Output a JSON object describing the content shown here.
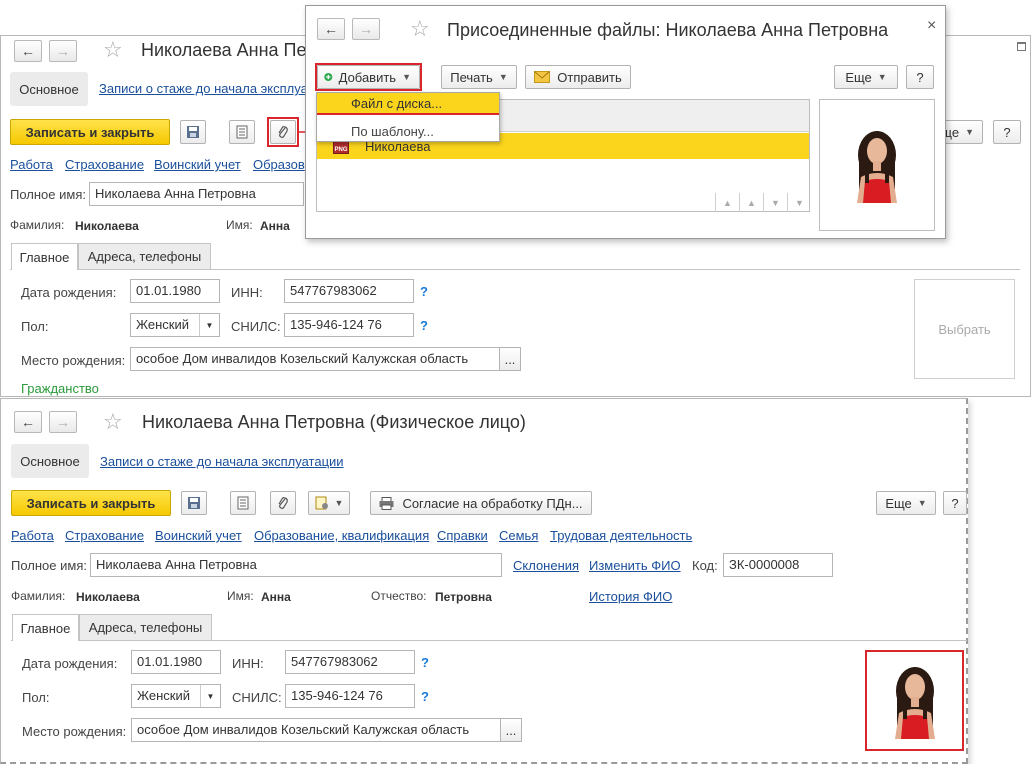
{
  "back_window": {
    "title": "Николаева Анна Пе",
    "tab_main": "Основное",
    "tab_link": "Записи о стаже до начала эксплуатации",
    "save_close": "Записать и закрыть",
    "more": "Еще",
    "help": "?",
    "links": [
      "Работа",
      "Страхование",
      "Воинский учет",
      "Образов"
    ],
    "full_name_label": "Полное имя:",
    "full_name_value": "Николаева Анна Петровна",
    "surname_label": "Фамилия:",
    "surname_value": "Николаева",
    "name_label": "Имя:",
    "name_value": "Анна",
    "tabs": [
      "Главное",
      "Адреса, телефоны"
    ],
    "birth_label": "Дата рождения:",
    "birth_value": "01.01.1980",
    "inn_label": "ИНН:",
    "inn_value": "547767983062",
    "sex_label": "Пол:",
    "sex_value": "Женский",
    "snils_label": "СНИЛС:",
    "snils_value": "135-946-124 76",
    "birthplace_label": "Место рождения:",
    "birthplace_value": "особое  Дом инвалидов  Козельский  Калужская область",
    "ellipsis": "...",
    "photo_select": "Выбрать",
    "citizenship": "Гражданство"
  },
  "dialog": {
    "title": "Присоединенные файлы: Николаева Анна Петровна",
    "close": "×",
    "add": "Добавить",
    "print": "Печать",
    "send": "Отправить",
    "more": "Еще",
    "help": "?",
    "menu_items": [
      "Файл с диска...",
      "По шаблону..."
    ],
    "file_type": "PNG",
    "file_name": "Николаева"
  },
  "front_window": {
    "title": "Николаева Анна Петровна (Физическое лицо)",
    "tab_main": "Основное",
    "tab_link": "Записи о стаже до начала эксплуатации",
    "save_close": "Записать и закрыть",
    "consent": "Согласие на обработку ПДн...",
    "more": "Еще",
    "help": "?",
    "links": [
      "Работа",
      "Страхование",
      "Воинский учет",
      "Образование, квалификация",
      "Справки",
      "Семья",
      "Трудовая деятельность"
    ],
    "full_name_label": "Полное имя:",
    "full_name_value": "Николаева Анна Петровна",
    "declension": "Склонения",
    "change_fio": "Изменить ФИО",
    "code_label": "Код:",
    "code_value": "ЗК-0000008",
    "surname_label": "Фамилия:",
    "surname_value": "Николаева",
    "name_label": "Имя:",
    "name_value": "Анна",
    "patronymic_label": "Отчество:",
    "patronymic_value": "Петровна",
    "fio_history": "История ФИО",
    "tabs": [
      "Главное",
      "Адреса, телефоны"
    ],
    "birth_label": "Дата рождения:",
    "birth_value": "01.01.1980",
    "inn_label": "ИНН:",
    "inn_value": "547767983062",
    "sex_label": "Пол:",
    "sex_value": "Женский",
    "snils_label": "СНИЛС:",
    "snils_value": "135-946-124 76",
    "birthplace_label": "Место рождения:",
    "birthplace_value": "особое  Дом инвалидов  Козельский  Калужская область",
    "ellipsis": "..."
  },
  "colors": {
    "accent_yellow": "#f5c800",
    "link_blue": "#1a4f9c",
    "highlight_red": "#d9262c",
    "selection_yellow": "#fbd51c"
  }
}
